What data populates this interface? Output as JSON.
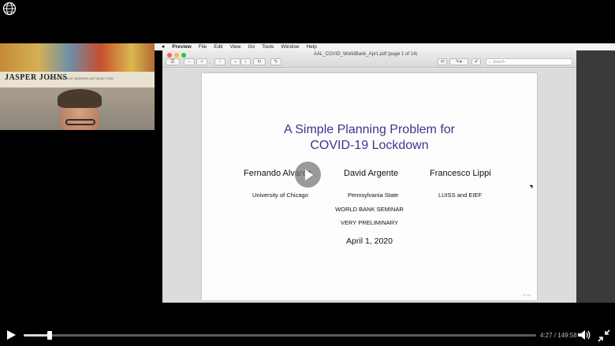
{
  "webcam": {
    "poster_title": "JASPER JOHNS",
    "poster_sub": "THE MUSEUM OF MODERN ART NEW YORK"
  },
  "menubar": {
    "items": [
      "Preview",
      "File",
      "Edit",
      "View",
      "Go",
      "Tools",
      "Window",
      "Help"
    ]
  },
  "window": {
    "title": "AAL_COVID_WorldBank_Apr1.pdf (page 1 of 14)",
    "search_placeholder": "Search",
    "traffic_light_colors": [
      "#ff5f57",
      "#febc2e",
      "#28c840"
    ]
  },
  "slide": {
    "title_line1": "A Simple Planning Problem for",
    "title_line2": "COVID-19 Lockdown",
    "authors": [
      {
        "name": "Fernando Alvarez",
        "affiliation": "University of Chicago"
      },
      {
        "name": "David Argente",
        "affiliation": "Pennsylvania State"
      },
      {
        "name": "Francesco Lippi",
        "affiliation": "LUISS and EIEF"
      }
    ],
    "seminar": "WORLD BANK SEMINAR",
    "status": "VERY PRELIMINARY",
    "date": "April 1, 2020",
    "page_number": "1 / 14",
    "title_color": "#3b3691"
  },
  "player": {
    "time": "4:27 / 149:58",
    "progress": 0.05
  }
}
